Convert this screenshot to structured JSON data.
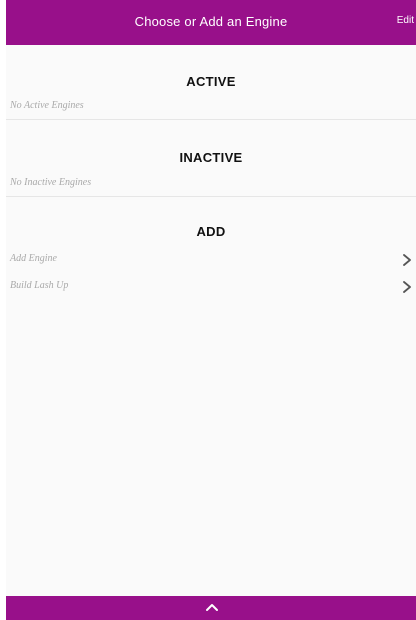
{
  "header": {
    "title": "Choose or Add an Engine",
    "edit_label": "Edit"
  },
  "sections": {
    "active": {
      "title": "ACTIVE",
      "empty_text": "No Active Engines"
    },
    "inactive": {
      "title": "INACTIVE",
      "empty_text": "No Inactive Engines"
    },
    "add": {
      "title": "ADD",
      "items": [
        {
          "label": "Add Engine",
          "icon": "chevron-right-icon"
        },
        {
          "label": "Build Lash Up",
          "icon": "chevron-right-icon"
        }
      ]
    }
  },
  "footer": {
    "icon": "chevron-up-icon"
  },
  "colors": {
    "accent": "#98108a",
    "muted_text": "#a9a9a9",
    "background": "#fafafa"
  }
}
